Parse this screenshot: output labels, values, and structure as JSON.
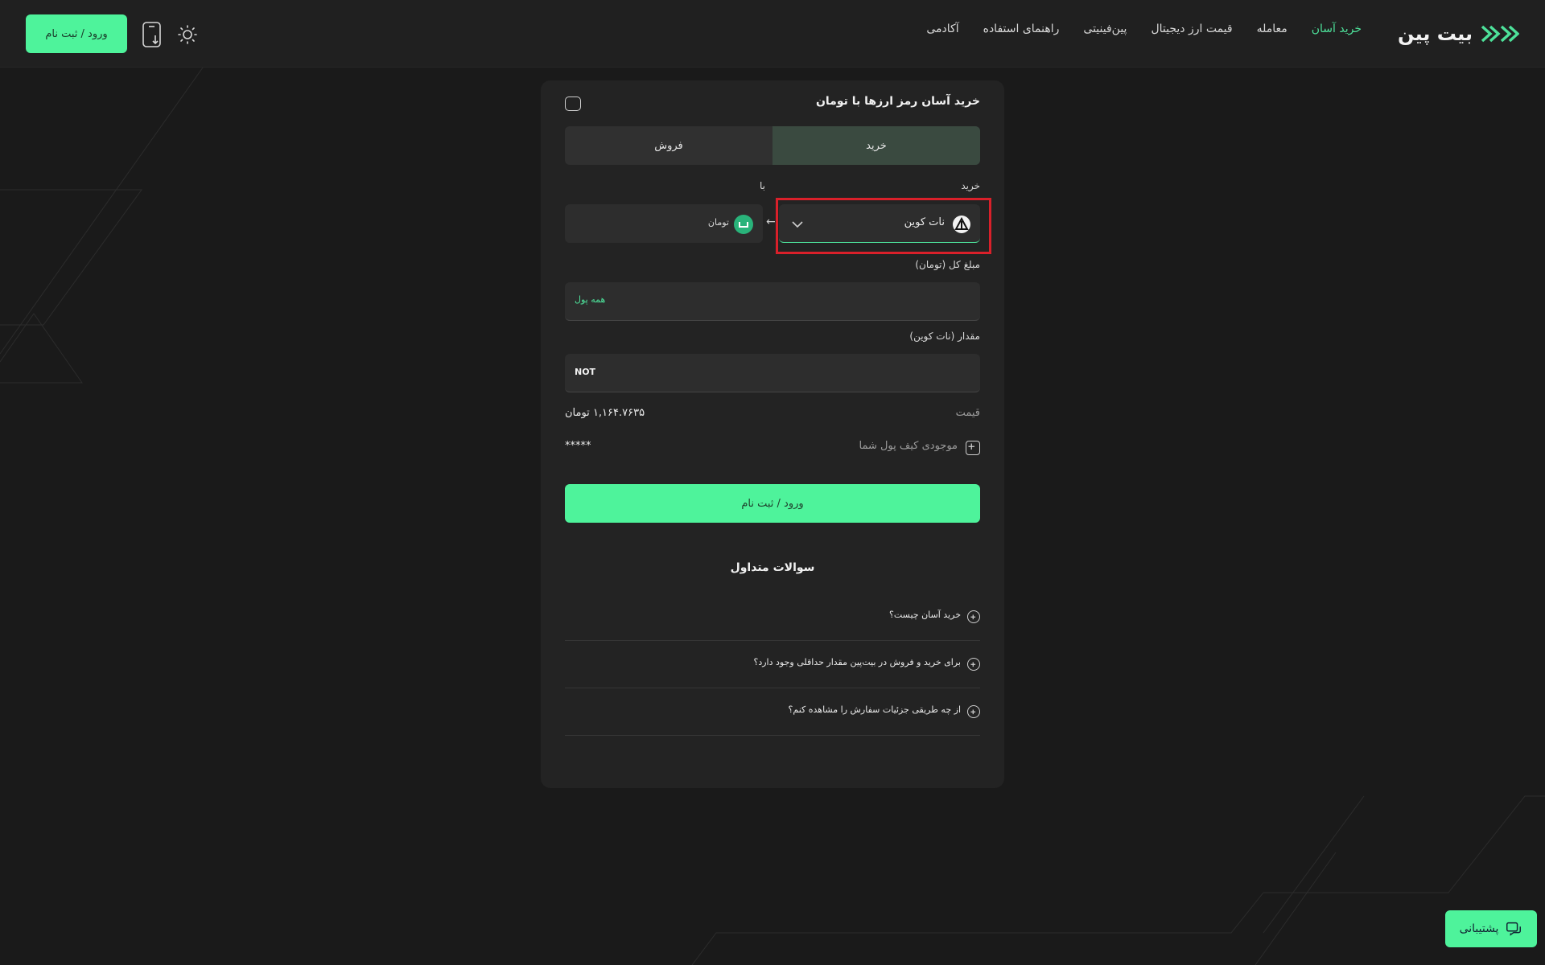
{
  "header": {
    "logo_text": "بیت پین",
    "nav": [
      {
        "label": "خرید آسان",
        "active": true
      },
      {
        "label": "معامله",
        "active": false
      },
      {
        "label": "قیمت ارز دیجیتال",
        "active": false
      },
      {
        "label": "پین‌فینیتی",
        "active": false
      },
      {
        "label": "راهنمای استفاده",
        "active": false
      },
      {
        "label": "آکادمی",
        "active": false
      }
    ],
    "login_label": "ورود / ثبت نام"
  },
  "card": {
    "title": "خرید آسان رمز ارزها با تومان",
    "tabs": [
      {
        "label": "خرید",
        "active": true
      },
      {
        "label": "فروش",
        "active": false
      }
    ],
    "buy_label": "خرید",
    "with_label": "با",
    "buy_coin": "نات کوین",
    "pay_currency": "تومان",
    "total_label": "مبلغ کل (تومان)",
    "all_money": "همه پول",
    "amount_label": "مقدار (نات کوین)",
    "amount_unit": "NOT",
    "price_label": "قیمت",
    "price_value": "۱,۱۶۴.۷۶۳۵ تومان",
    "balance_label": "موجودی کیف پول شما",
    "balance_value": "*****",
    "submit_label": "ورود / ثبت نام"
  },
  "faq": {
    "title": "سوالات متداول",
    "items": [
      "خرید آسان چیست؟",
      "برای خرید و فروش در بیت‌پین مقدار حداقلی وجود دارد؟",
      "از چه طریقی جزئیات سفارش را مشاهده کنم؟"
    ]
  },
  "support_label": "پشتیبانی",
  "colors": {
    "accent": "#4ef39b",
    "background": "#1a1a1a",
    "card": "#232323",
    "highlight": "#d9202a"
  }
}
